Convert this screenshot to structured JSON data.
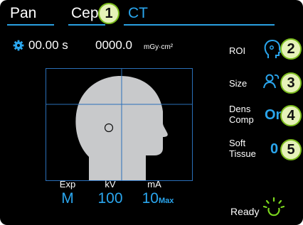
{
  "tabs": [
    {
      "label": "Pan"
    },
    {
      "label": "Cep"
    },
    {
      "label": "CT"
    }
  ],
  "callouts": [
    "1",
    "2",
    "3",
    "4",
    "5"
  ],
  "exposure": {
    "time": "00.00 s",
    "dose": "0000.0",
    "dose_unit": "mGy·cm²"
  },
  "side_params": {
    "roi_label": "ROI",
    "size_label": "Size",
    "dens_comp_label_line1": "Dens",
    "dens_comp_label_line2": "Comp",
    "dens_comp_value": "On",
    "soft_tissue_label_line1": "Soft",
    "soft_tissue_label_line2": "Tissue",
    "soft_tissue_value": "0"
  },
  "params": {
    "exp_label": "Exp",
    "exp_value": "M",
    "kv_label": "kV",
    "kv_value": "100",
    "ma_label": "mA",
    "ma_value": "10",
    "ma_suffix": "Max"
  },
  "status": {
    "ready_label": "Ready"
  },
  "colors": {
    "background": "#000000",
    "accent_blue": "#2aa6ee",
    "head_silhouette": "#c8c9cb",
    "callout_fill": "#e6f2b8",
    "callout_border": "#7cbd1e",
    "ready_indicator": "#7cd81e"
  },
  "icons": [
    "gear-icon",
    "roi-head-icon",
    "size-persons-icon",
    "ready-spinner-icon"
  ]
}
